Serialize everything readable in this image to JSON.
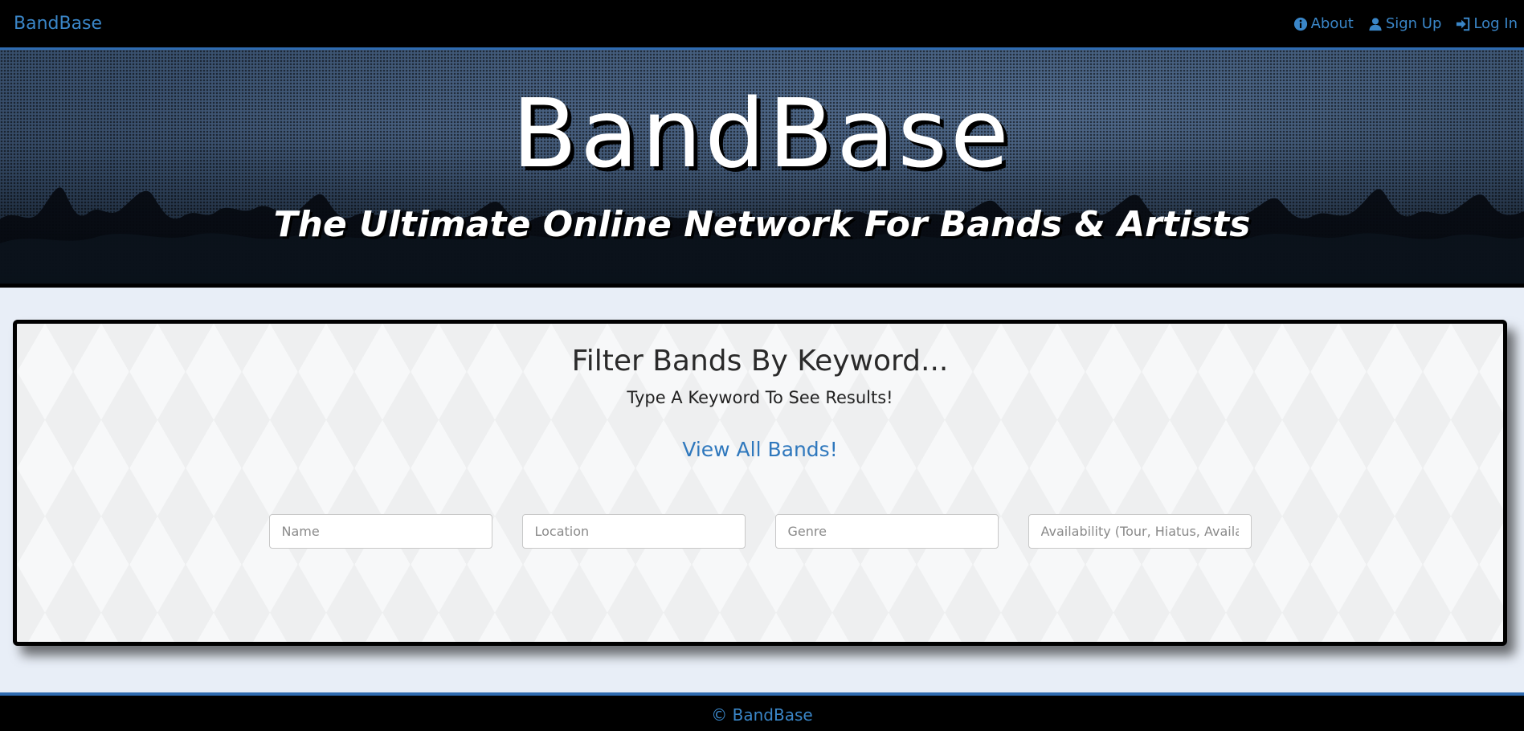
{
  "navbar": {
    "brand": "BandBase",
    "links": [
      {
        "label": "About",
        "icon": "info-icon"
      },
      {
        "label": "Sign Up",
        "icon": "user-icon"
      },
      {
        "label": "Log In",
        "icon": "login-icon"
      }
    ]
  },
  "hero": {
    "title": "BandBase",
    "subtitle": "The Ultimate Online Network For Bands & Artists"
  },
  "filter_panel": {
    "title": "Filter Bands By Keyword...",
    "subtitle": "Type A Keyword To See Results!",
    "view_all_label": "View All Bands!",
    "inputs": {
      "name_placeholder": "Name",
      "location_placeholder": "Location",
      "genre_placeholder": "Genre",
      "availability_placeholder": "Availability (Tour, Hiatus, Available)"
    }
  },
  "footer": {
    "text": "© BandBase"
  },
  "colors": {
    "accent": "#3a86c8",
    "navbar_bg": "#000000",
    "nav_border": "#2f6bb0",
    "page_bg": "#e8eef7"
  }
}
